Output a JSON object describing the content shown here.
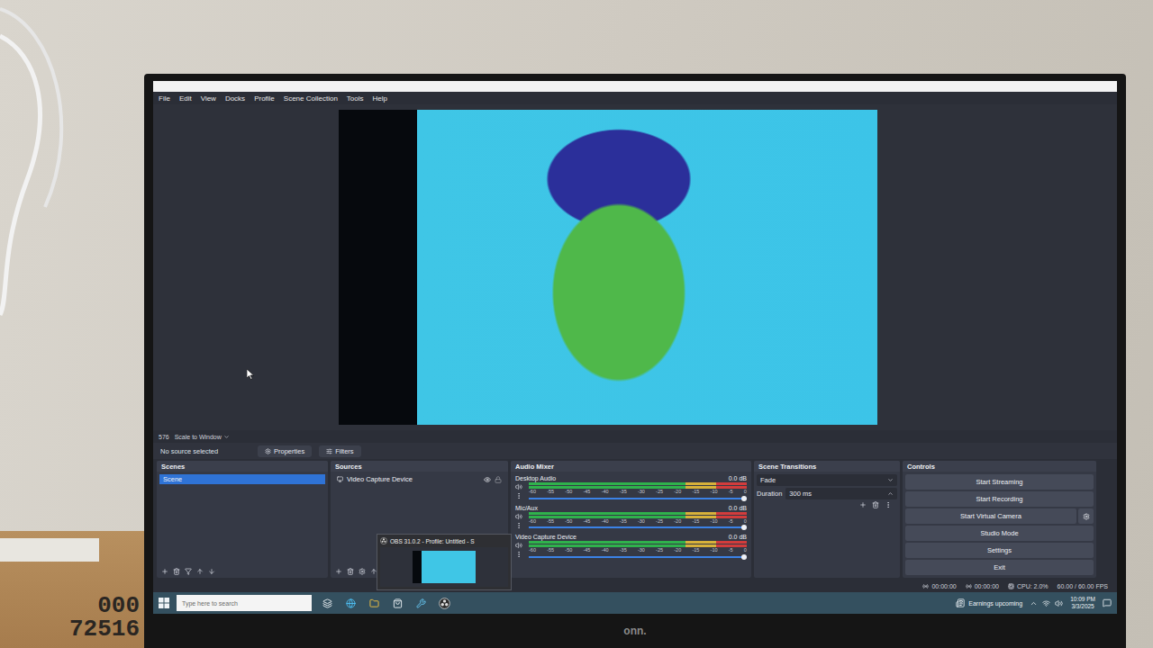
{
  "monitor": {
    "brand": "onn."
  },
  "box": {
    "label": [
      "000",
      "72516"
    ]
  },
  "menu": [
    "File",
    "Edit",
    "View",
    "Docks",
    "Profile",
    "Scene Collection",
    "Tools",
    "Help"
  ],
  "preview": {
    "scale_value": "576",
    "scale": "Scale to Window"
  },
  "source_bar": {
    "status": "No source selected",
    "buttons": [
      "Properties",
      "Filters"
    ]
  },
  "scenes": {
    "title": "Scenes",
    "items": [
      {
        "label": "Scene",
        "selected": true
      }
    ]
  },
  "sources": {
    "title": "Sources",
    "items": [
      {
        "label": "Video Capture Device",
        "visible": true,
        "locked": false
      }
    ]
  },
  "audio_mixer": {
    "title": "Audio Mixer",
    "ticks": [
      "-60",
      "-55",
      "-50",
      "-45",
      "-40",
      "-35",
      "-30",
      "-25",
      "-20",
      "-15",
      "-10",
      "-5",
      "0"
    ],
    "channels": [
      {
        "name": "Desktop Audio",
        "reading": "0.0 dB",
        "level": 1,
        "muted": false
      },
      {
        "name": "Mic/Aux",
        "reading": "0.0 dB",
        "level": 1,
        "muted": false
      },
      {
        "name": "Video Capture Device",
        "reading": "0.0 dB",
        "level": 1,
        "muted": false
      }
    ]
  },
  "transitions": {
    "title": "Scene Transitions",
    "type": "Fade",
    "duration_label": "Duration",
    "duration": "300 ms"
  },
  "controls": {
    "title": "Controls",
    "buttons": [
      "Start Streaming",
      "Start Recording",
      "Start Virtual Camera",
      "Studio Mode",
      "Settings",
      "Exit"
    ]
  },
  "status_bar": {
    "times": [
      "00:00:00",
      "00:00:00"
    ],
    "cpu": "CPU: 2.0%",
    "fps": "60.00 / 60.00 FPS"
  },
  "taskbar": {
    "search_placeholder": "Type here to search",
    "news": "Earnings upcoming",
    "time": "10:09 PM",
    "date": "3/3/2025"
  },
  "thumbnail": {
    "title": "OBS 31.0.2 - Profile: Untitled - S"
  }
}
